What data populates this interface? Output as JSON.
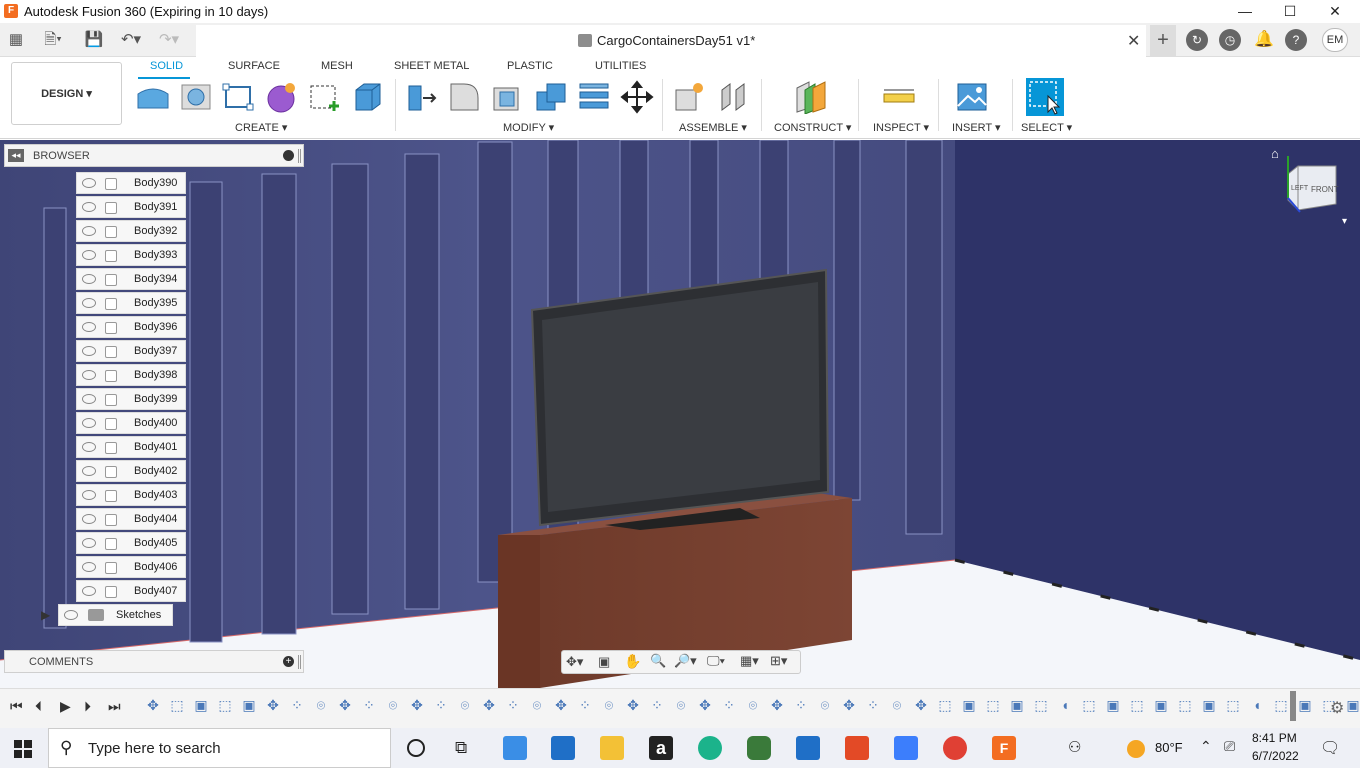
{
  "window": {
    "title": "Autodesk Fusion 360 (Expiring in 10 days)",
    "min": "—",
    "max": "☐",
    "close": "✕"
  },
  "tab": {
    "document_title": "CargoContainersDay51 v1*",
    "close": "✕"
  },
  "user": {
    "initials": "EM"
  },
  "toolbar": {
    "workspace": "DESIGN ▾",
    "tabs": [
      "SOLID",
      "SURFACE",
      "MESH",
      "SHEET METAL",
      "PLASTIC",
      "UTILITIES"
    ],
    "groups": [
      "CREATE ▾",
      "MODIFY ▾",
      "ASSEMBLE ▾",
      "CONSTRUCT ▾",
      "INSPECT ▾",
      "INSERT ▾",
      "SELECT ▾"
    ]
  },
  "browser": {
    "label": "BROWSER",
    "bodies": [
      "Body390",
      "Body391",
      "Body392",
      "Body393",
      "Body394",
      "Body395",
      "Body396",
      "Body397",
      "Body398",
      "Body399",
      "Body400",
      "Body401",
      "Body402",
      "Body403",
      "Body404",
      "Body405",
      "Body406",
      "Body407"
    ],
    "sketches": "Sketches"
  },
  "comments": {
    "label": "COMMENTS"
  },
  "viewcube": {
    "left": "LEFT",
    "front": "FRONT"
  },
  "taskbar": {
    "search_placeholder": "Type here to search",
    "weather": "80°F",
    "time": "8:41 PM",
    "date": "6/7/2022"
  },
  "colors": {
    "accent": "#0696d7",
    "fusion": "#f36d21",
    "wall": "#454b7a",
    "cabinet": "#7a4030"
  }
}
